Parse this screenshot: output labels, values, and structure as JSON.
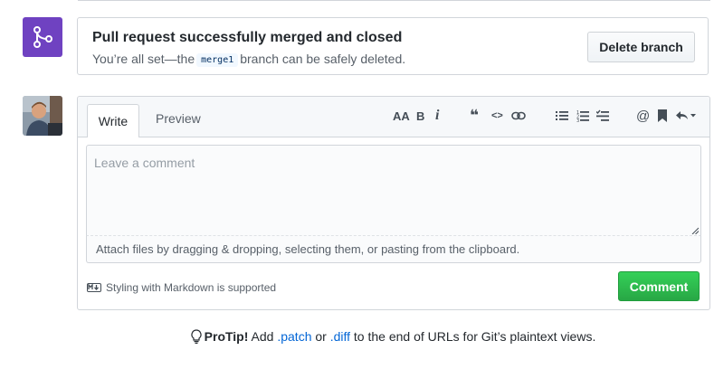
{
  "merge": {
    "title": "Pull request successfully merged and closed",
    "sub_before": "You’re all set—the",
    "branch": "merge1",
    "sub_after": "branch can be safely deleted.",
    "delete_button": "Delete branch"
  },
  "editor": {
    "tabs": {
      "write": "Write",
      "preview": "Preview"
    },
    "toolbar": {
      "heading": "AA",
      "bold": "B",
      "italic": "i",
      "quote": "❝",
      "code": "<>",
      "at": "@"
    },
    "placeholder": "Leave a comment",
    "attach_hint": "Attach files by dragging & dropping, selecting them, or pasting from the clipboard.",
    "markdown_note": "Styling with Markdown is supported",
    "comment_button": "Comment"
  },
  "protip": {
    "label": "ProTip!",
    "text1": "Add",
    "link1": ".patch",
    "text2": "or",
    "link2": ".diff",
    "text3": "to the end of URLs for Git’s plaintext views."
  },
  "colors": {
    "merged_purple": "#6f42c1",
    "comment_green": "#28a745",
    "link_blue": "#0366d6"
  }
}
